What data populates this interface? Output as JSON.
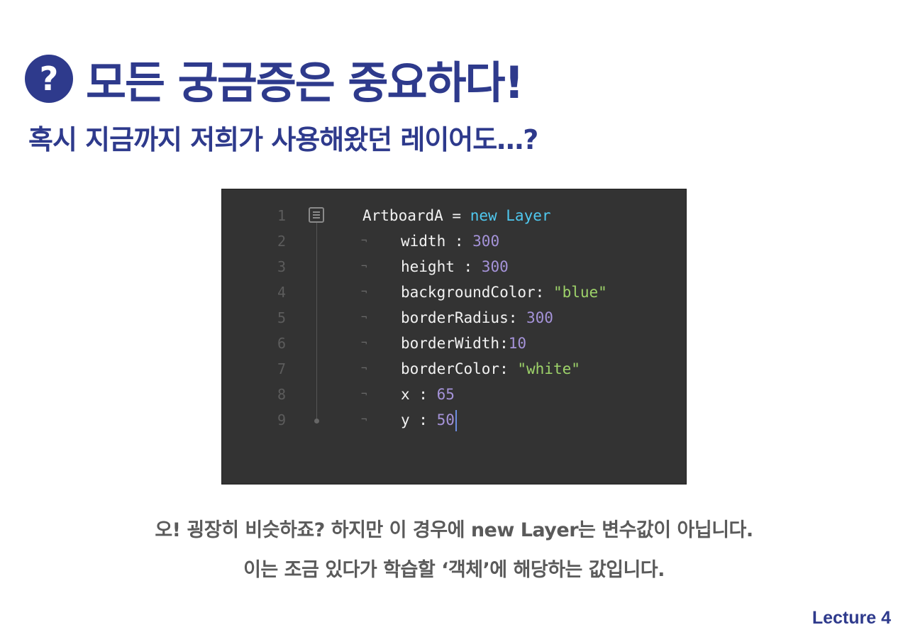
{
  "title": {
    "badge": "?",
    "text": "모든 궁금증은 중요하다!"
  },
  "subtitle": "혹시 지금까지 저희가 사용해왔던 레이어도…?",
  "code": {
    "lines": [
      {
        "num": "1",
        "parts": [
          {
            "t": "ArtboardA = ",
            "c": "plain"
          },
          {
            "t": "new Layer",
            "c": "kw"
          }
        ]
      },
      {
        "num": "2",
        "parts": [
          {
            "t": "width : ",
            "c": "plain"
          },
          {
            "t": "300",
            "c": "num"
          }
        ]
      },
      {
        "num": "3",
        "parts": [
          {
            "t": "height : ",
            "c": "plain"
          },
          {
            "t": "300",
            "c": "num"
          }
        ]
      },
      {
        "num": "4",
        "parts": [
          {
            "t": "backgroundColor: ",
            "c": "plain"
          },
          {
            "t": "\"blue\"",
            "c": "str"
          }
        ]
      },
      {
        "num": "5",
        "parts": [
          {
            "t": "borderRadius: ",
            "c": "plain"
          },
          {
            "t": "300",
            "c": "num"
          }
        ]
      },
      {
        "num": "6",
        "parts": [
          {
            "t": "borderWidth:",
            "c": "plain"
          },
          {
            "t": "10",
            "c": "num"
          }
        ]
      },
      {
        "num": "7",
        "parts": [
          {
            "t": "borderColor: ",
            "c": "plain"
          },
          {
            "t": "\"white\"",
            "c": "str"
          }
        ]
      },
      {
        "num": "8",
        "parts": [
          {
            "t": "x : ",
            "c": "plain"
          },
          {
            "t": "65",
            "c": "num"
          }
        ]
      },
      {
        "num": "9",
        "parts": [
          {
            "t": "y : ",
            "c": "plain"
          },
          {
            "t": "50",
            "c": "num"
          }
        ]
      }
    ],
    "tab_glyph": "¬",
    "colors": {
      "background": "#333333",
      "keyword": "#4fc8ef",
      "number": "#a593d9",
      "string": "#9ed36a",
      "text": "#f2f2f2"
    }
  },
  "body": {
    "line1": "오! 굉장히 비슷하죠? 하지만 이 경우에 new Layer는 변수값이 아닙니다.",
    "line2": "이는 조금 있다가 학습할 ‘객체’에 해당하는 값입니다."
  },
  "footer": "Lecture 4",
  "colors": {
    "accent": "#2e3a8c",
    "body_text": "#5a5a5a"
  }
}
